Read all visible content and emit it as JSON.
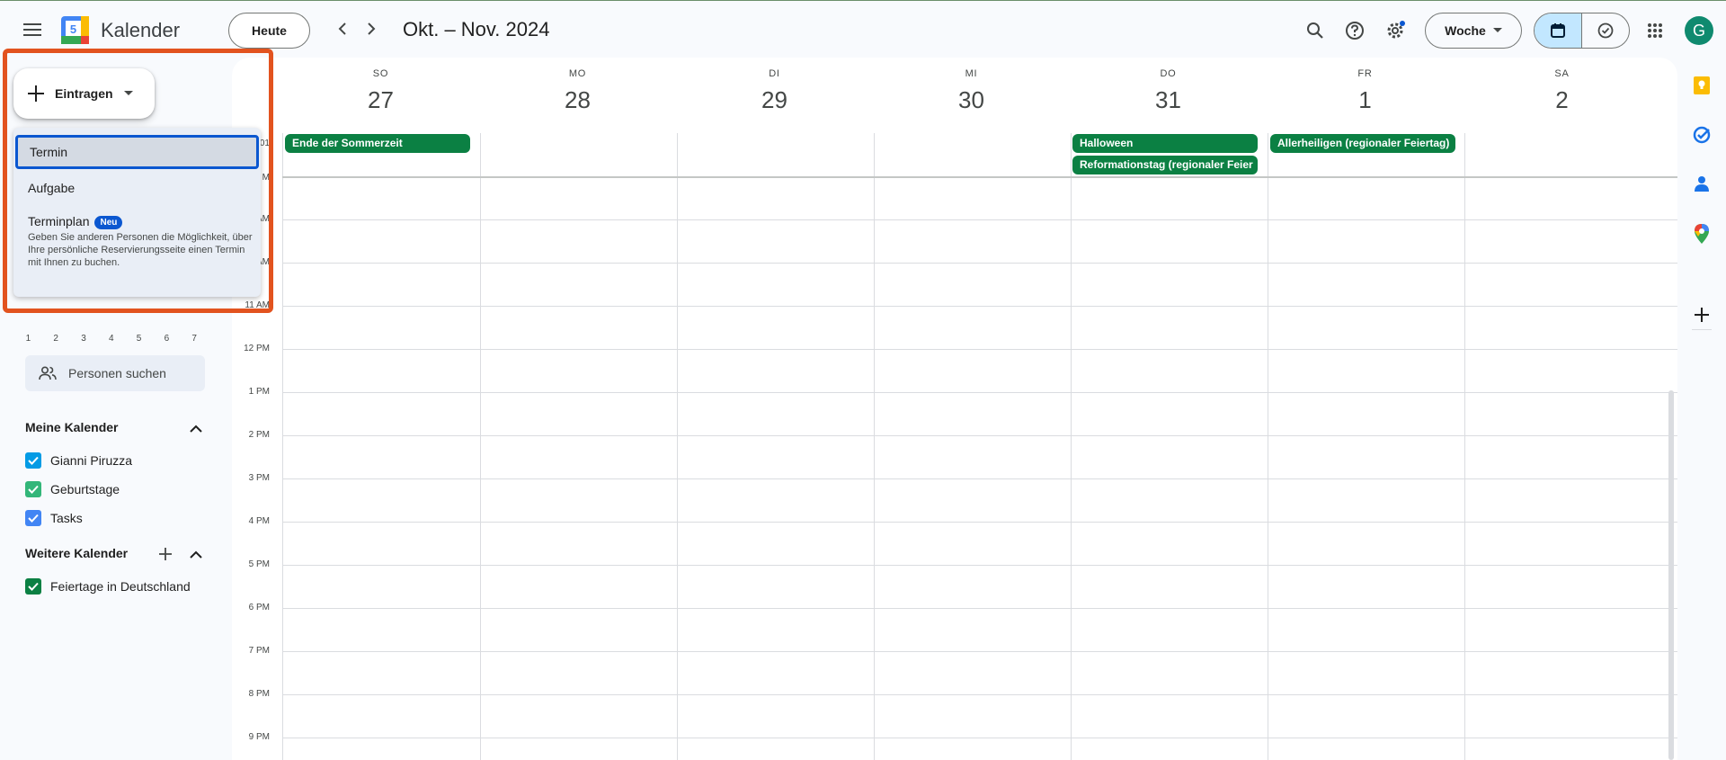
{
  "header": {
    "app_title": "Kalender",
    "logo_day": "5",
    "today_button": "Heute",
    "date_range": "Okt. – Nov. 2024",
    "view_select": "Woche",
    "avatar_initial": "G"
  },
  "create_menu": {
    "button_label": "Eintragen",
    "items": [
      {
        "label": "Termin",
        "selected": true
      },
      {
        "label": "Aufgabe"
      },
      {
        "label": "Terminplan",
        "badge": "Neu",
        "description": "Geben Sie anderen Personen die Möglichkeit, über Ihre persönliche Reservierungsseite einen Termin mit Ihnen zu buchen."
      }
    ]
  },
  "minicalendar_row": [
    "1",
    "2",
    "3",
    "4",
    "5",
    "6",
    "7"
  ],
  "people_search": "Personen suchen",
  "my_calendars": {
    "title": "Meine Kalender",
    "items": [
      {
        "label": "Gianni Piruzza",
        "color": "#039be5"
      },
      {
        "label": "Geburtstage",
        "color": "#33b679"
      },
      {
        "label": "Tasks",
        "color": "#4285f4"
      }
    ]
  },
  "other_calendars": {
    "title": "Weitere Kalender",
    "items": [
      {
        "label": "Feiertage in Deutschland",
        "color": "#0b8043"
      }
    ]
  },
  "days": [
    {
      "name": "SO",
      "num": "27"
    },
    {
      "name": "MO",
      "num": "28"
    },
    {
      "name": "DI",
      "num": "29"
    },
    {
      "name": "MI",
      "num": "30"
    },
    {
      "name": "DO",
      "num": "31"
    },
    {
      "name": "FR",
      "num": "1"
    },
    {
      "name": "SA",
      "num": "2"
    }
  ],
  "allday_events": [
    {
      "label": "Ende der Sommerzeit",
      "day": "SO",
      "color": "#0b8043"
    },
    {
      "label": "Halloween",
      "day": "DO",
      "color": "#0b8043"
    },
    {
      "label": "Reformationstag (regionaler Feier",
      "day": "DO",
      "color": "#0b8043"
    },
    {
      "label": "Allerheiligen (regionaler Feiertag)",
      "day": "FR",
      "color": "#0b8043"
    }
  ],
  "time_labels": {
    "partial_1": "01",
    "partial_2": "M",
    "partial_3": "AM",
    "partial_4": "AM",
    "t11": "11 AM",
    "t12": "12 PM",
    "t1": "1 PM",
    "t2": "2 PM",
    "t3": "3 PM",
    "t4": "4 PM",
    "t5": "5 PM",
    "t6": "6 PM",
    "t7": "7 PM",
    "t8": "8 PM",
    "t9": "9 PM"
  },
  "colors": {
    "accent": "#0b57d0",
    "event": "#0b8043",
    "highlight_frame": "#e2531f"
  }
}
